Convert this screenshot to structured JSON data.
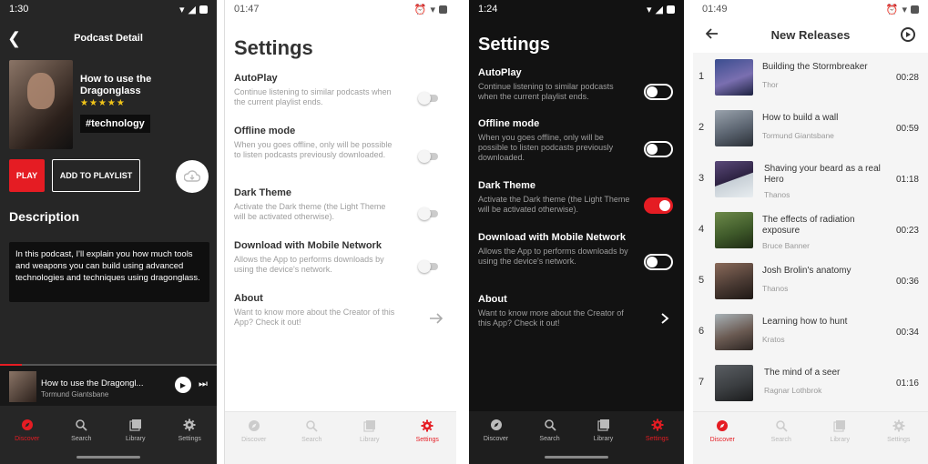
{
  "colors": {
    "accent": "#e51c23",
    "star": "#f0c419"
  },
  "podcast_detail": {
    "status_time": "1:30",
    "title": "Podcast Detail",
    "podcast_title": "How to use the Dragonglass",
    "rating_stars": "★★★★★",
    "tag": "#technology",
    "play_label": "PLAY",
    "add_label": "ADD TO PLAYLIST",
    "description_heading": "Description",
    "description": "In this podcast, I'll explain you how much tools and weapons you can build using advanced technologies and techniques using dragonglass.",
    "mini_player": {
      "title": "How to use the Dragongl...",
      "author": "Tormund Giantsbane",
      "progress": 0.1
    },
    "nav": [
      "Discover",
      "Search",
      "Library",
      "Settings"
    ]
  },
  "settings_light": {
    "status_time": "01:47",
    "title": "Settings",
    "items": [
      {
        "heading": "AutoPlay",
        "desc": "Continue listening to similar podcasts when the current playlist ends.",
        "on": false
      },
      {
        "heading": "Offline mode",
        "desc": "When you goes offline, only will be possible to listen podcasts previously downloaded.",
        "on": false
      },
      {
        "heading": "Dark Theme",
        "desc": "Activate the Dark theme (the Light Theme will be activated otherwise).",
        "on": false
      },
      {
        "heading": "Download with Mobile Network",
        "desc": "Allows the App to performs downloads by using the device's network.",
        "on": false
      }
    ],
    "about": {
      "heading": "About",
      "desc": "Want to know more about the Creator of this App? Check it out!"
    },
    "nav": [
      "Discover",
      "Search",
      "Library",
      "Settings"
    ]
  },
  "settings_dark": {
    "status_time": "1:24",
    "title": "Settings",
    "items": [
      {
        "heading": "AutoPlay",
        "desc": "Continue listening to similar podcasts when the current playlist ends.",
        "on": false
      },
      {
        "heading": "Offline mode",
        "desc": "When you goes offline, only will be possible to listen podcasts previously downloaded.",
        "on": false
      },
      {
        "heading": "Dark Theme",
        "desc": "Activate the Dark theme (the Light Theme will be activated otherwise).",
        "on": true
      },
      {
        "heading": "Download with Mobile Network",
        "desc": "Allows the App to performs downloads by using the device's network.",
        "on": false
      }
    ],
    "about": {
      "heading": "About",
      "desc": "Want to know more about the Creator of this App? Check it out!"
    },
    "nav": [
      "Discover",
      "Search",
      "Library",
      "Settings"
    ]
  },
  "new_releases": {
    "status_time": "01:49",
    "title": "New Releases",
    "items": [
      {
        "num": "1",
        "title": "Building the Stormbreaker",
        "artist": "Thor",
        "duration": "00:28"
      },
      {
        "num": "2",
        "title": "How to build a wall",
        "artist": "Tormund Giantsbane",
        "duration": "00:59"
      },
      {
        "num": "3",
        "title": "Shaving your beard as a real Hero",
        "artist": "Thanos",
        "duration": "01:18"
      },
      {
        "num": "4",
        "title": "The effects of radiation exposure",
        "artist": "Bruce Banner",
        "duration": "00:23"
      },
      {
        "num": "5",
        "title": "Josh Brolin's anatomy",
        "artist": "Thanos",
        "duration": "00:36"
      },
      {
        "num": "6",
        "title": "Learning how to hunt",
        "artist": "Kratos",
        "duration": "00:34"
      },
      {
        "num": "7",
        "title": "The mind of a seer",
        "artist": "Ragnar Lothbrok",
        "duration": "01:16"
      }
    ],
    "nav": [
      "Discover",
      "Search",
      "Library",
      "Settings"
    ]
  }
}
